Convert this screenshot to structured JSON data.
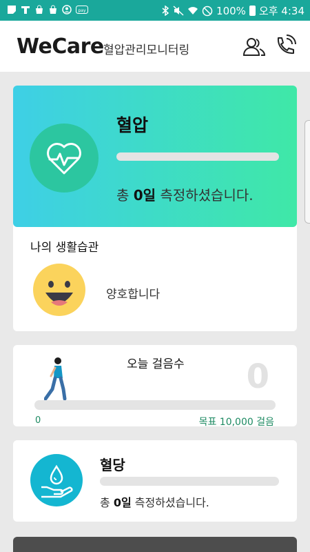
{
  "status_bar": {
    "battery_percent": "100%",
    "time": "오후 4:34",
    "icons": [
      "notification-icon",
      "alert-icon",
      "shopping-bag-icon",
      "shopping-bag-icon",
      "account-icon",
      "pay-icon",
      "bluetooth-icon",
      "mute-icon",
      "wifi-icon",
      "no-disturb-icon",
      "battery-icon"
    ]
  },
  "header": {
    "brand": "WeCare",
    "subtitle": "혈압관리모니터링",
    "icons": [
      "group-icon",
      "phone-icon"
    ]
  },
  "blood_pressure": {
    "title": "혈압",
    "count_prefix": "총 ",
    "count_value": "0일",
    "count_suffix": " 측정하셨습니다.",
    "progress": 0,
    "icon": "heart-pulse-icon",
    "colors": {
      "gradient_start": "#3ecfe6",
      "gradient_end": "#3fe8a7",
      "circle": "#2cc6a0"
    }
  },
  "habits": {
    "title": "나의 생활습관",
    "status": "양호합니다",
    "icon": "happy-face-icon"
  },
  "steps": {
    "title": "오늘 걸음수",
    "value": "0",
    "min_label": "0",
    "goal_label": "목표 10,000 걸음",
    "progress": 0,
    "icon": "walking-person-icon"
  },
  "blood_sugar": {
    "title": "혈당",
    "count_prefix": "총 ",
    "count_value": "0일",
    "count_suffix": " 측정하셨습니다.",
    "progress": 0,
    "icon": "hand-drop-icon",
    "colors": {
      "circle": "#14b6d1"
    }
  }
}
